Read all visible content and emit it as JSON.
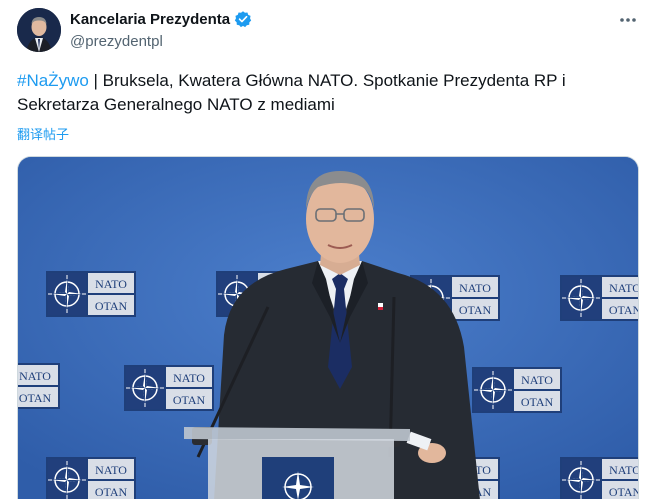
{
  "author": {
    "display_name": "Kancelaria Prezydenta",
    "handle": "@prezydentpl"
  },
  "post": {
    "hashtag": "#NaŻywo",
    "text": " | Bruksela, Kwatera Główna NATO. Spotkanie Prezydenta RP i Sekretarza Generalnego NATO z mediami",
    "translate_label": "翻译帖子"
  },
  "media": {
    "logo_text_top": "NATO",
    "logo_text_bottom": "OTAN"
  },
  "colors": {
    "accent": "#1d9bf0",
    "backdrop": "#3f6fbf"
  },
  "icons": {
    "verified": "verified-badge-icon",
    "more": "more-options-icon"
  }
}
